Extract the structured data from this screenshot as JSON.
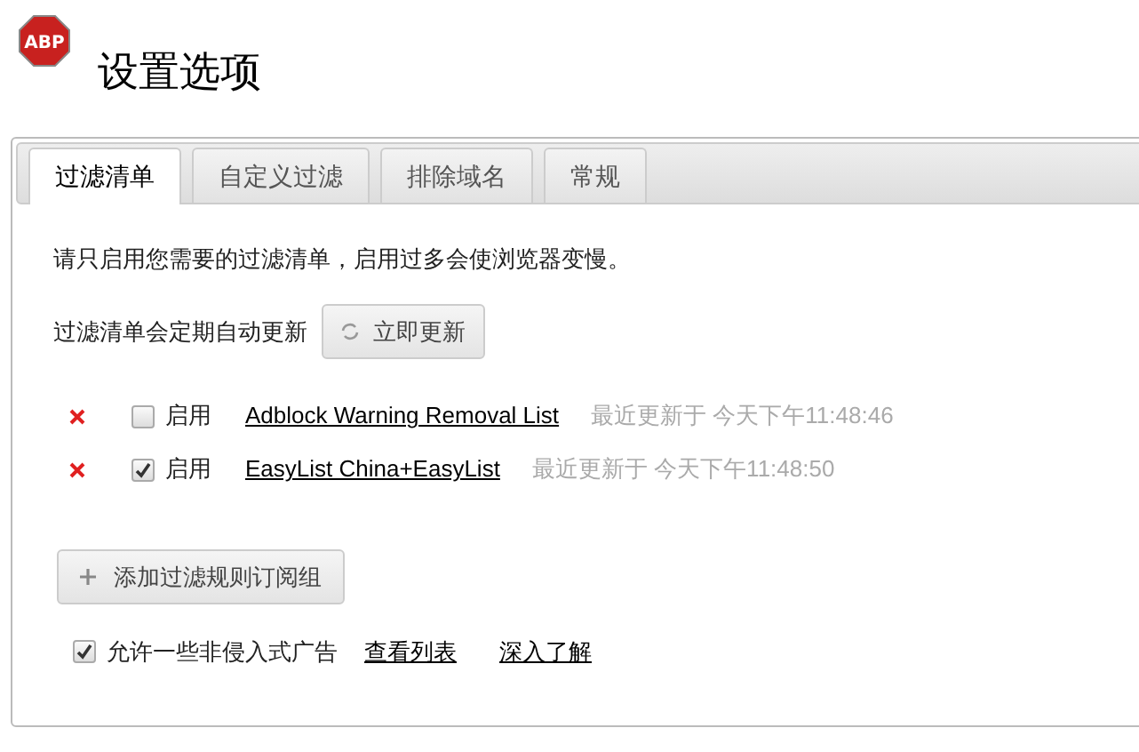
{
  "logo": {
    "text": "ABP"
  },
  "title": "设置选项",
  "tabs": [
    {
      "label": "过滤清单",
      "selected": true
    },
    {
      "label": "自定义过滤",
      "selected": false
    },
    {
      "label": "排除域名",
      "selected": false
    },
    {
      "label": "常规",
      "selected": false
    }
  ],
  "notice": "请只启用您需要的过滤清单，启用过多会使浏览器变慢。",
  "update": {
    "label": "过滤清单会定期自动更新",
    "button": "立即更新"
  },
  "subscriptions": [
    {
      "enabled": false,
      "enable_label": "启用",
      "name": "Adblock Warning Removal List",
      "updated": "最近更新于 今天下午11:48:46"
    },
    {
      "enabled": true,
      "enable_label": "启用",
      "name": "EasyList China+EasyList",
      "updated": "最近更新于 今天下午11:48:50"
    }
  ],
  "add_button": "添加过滤规则订阅组",
  "acceptable_ads": {
    "checked": true,
    "label": "允许一些非侵入式广告",
    "links": [
      "查看列表",
      "深入了解"
    ]
  }
}
